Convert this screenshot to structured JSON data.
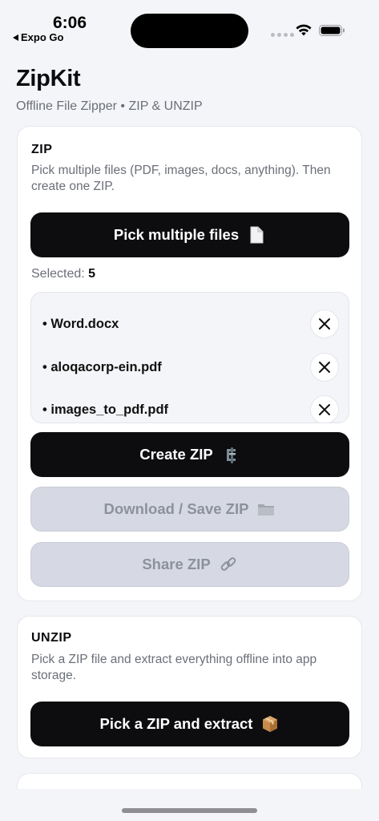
{
  "status_bar": {
    "time": "6:06",
    "back_app": "Expo Go"
  },
  "header": {
    "title": "ZipKit",
    "subtitle": "Offline File Zipper • ZIP & UNZIP"
  },
  "zip_card": {
    "title": "ZIP",
    "description": "Pick multiple files (PDF, images, docs, anything). Then create one ZIP.",
    "pick_button": "Pick multiple files",
    "pick_icon": "page-icon",
    "selected_label": "Selected:",
    "selected_count": "5",
    "files": [
      {
        "name": "• Word.docx"
      },
      {
        "name": "• aloqacorp-ein.pdf"
      },
      {
        "name": "• images_to_pdf.pdf"
      }
    ],
    "create_button": "Create ZIP",
    "create_icon": "clamp-icon",
    "download_button": "Download / Save ZIP",
    "download_icon": "folder-icon",
    "share_button": "Share ZIP",
    "share_icon": "link-icon"
  },
  "unzip_card": {
    "title": "UNZIP",
    "description": "Pick a ZIP file and extract everything offline into app storage.",
    "extract_button": "Pick a ZIP and extract",
    "extract_icon": "package-icon"
  }
}
